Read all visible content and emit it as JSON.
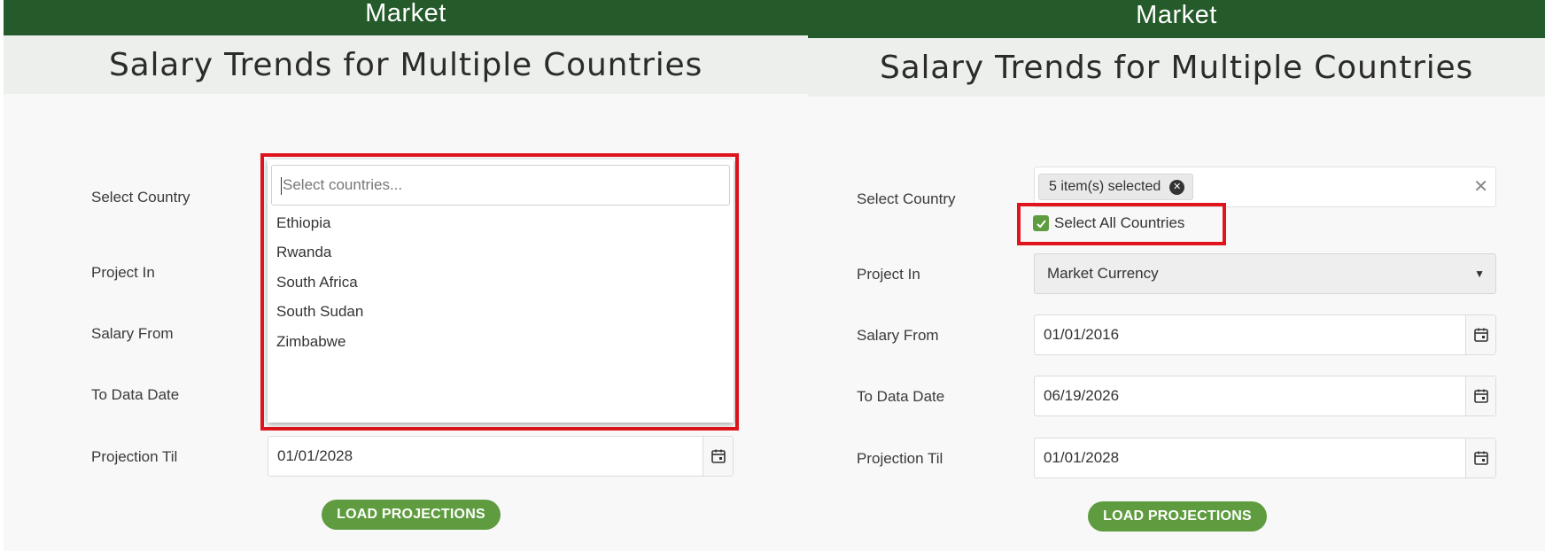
{
  "left": {
    "topbar_title": "Market",
    "page_title": "Salary Trends for Multiple Countries",
    "labels": {
      "select_country": "Select Country",
      "project_in": "Project In",
      "salary_from": "Salary From",
      "to_data_date": "To Data Date",
      "projection_til": "Projection Til"
    },
    "country_search_placeholder": "Select countries...",
    "country_options": [
      "Ethiopia",
      "Rwanda",
      "South Africa",
      "South Sudan",
      "Zimbabwe"
    ],
    "projection_til_value": "01/01/2028",
    "load_button": "LOAD PROJECTIONS"
  },
  "right": {
    "topbar_title": "Market",
    "page_title": "Salary Trends for Multiple Countries",
    "labels": {
      "select_country": "Select Country",
      "project_in": "Project In",
      "salary_from": "Salary From",
      "to_data_date": "To Data Date",
      "projection_til": "Projection Til"
    },
    "selected_chip": "5 item(s) selected",
    "select_all_label": "Select All Countries",
    "select_all_checked": true,
    "project_in_value": "Market Currency",
    "salary_from_value": "01/01/2016",
    "to_data_date_value": "06/19/2026",
    "projection_til_value": "01/01/2028",
    "load_button": "LOAD PROJECTIONS"
  },
  "colors": {
    "header_green": "#255b2b",
    "button_green": "#5e9c3f",
    "highlight_red": "#e0141c"
  }
}
